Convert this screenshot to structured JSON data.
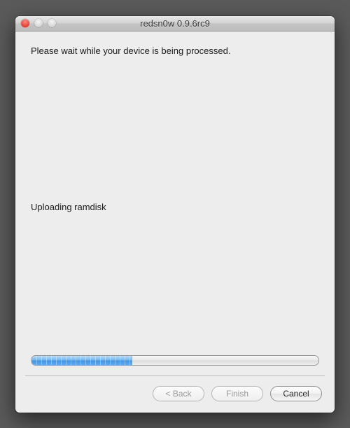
{
  "window": {
    "title": "redsn0w 0.9.6rc9"
  },
  "content": {
    "instruction": "Please wait while your device is being processed.",
    "status": "Uploading ramdisk",
    "progress_percent": 35
  },
  "buttons": {
    "back_label": "< Back",
    "back_enabled": false,
    "finish_label": "Finish",
    "finish_enabled": false,
    "cancel_label": "Cancel",
    "cancel_enabled": true
  }
}
